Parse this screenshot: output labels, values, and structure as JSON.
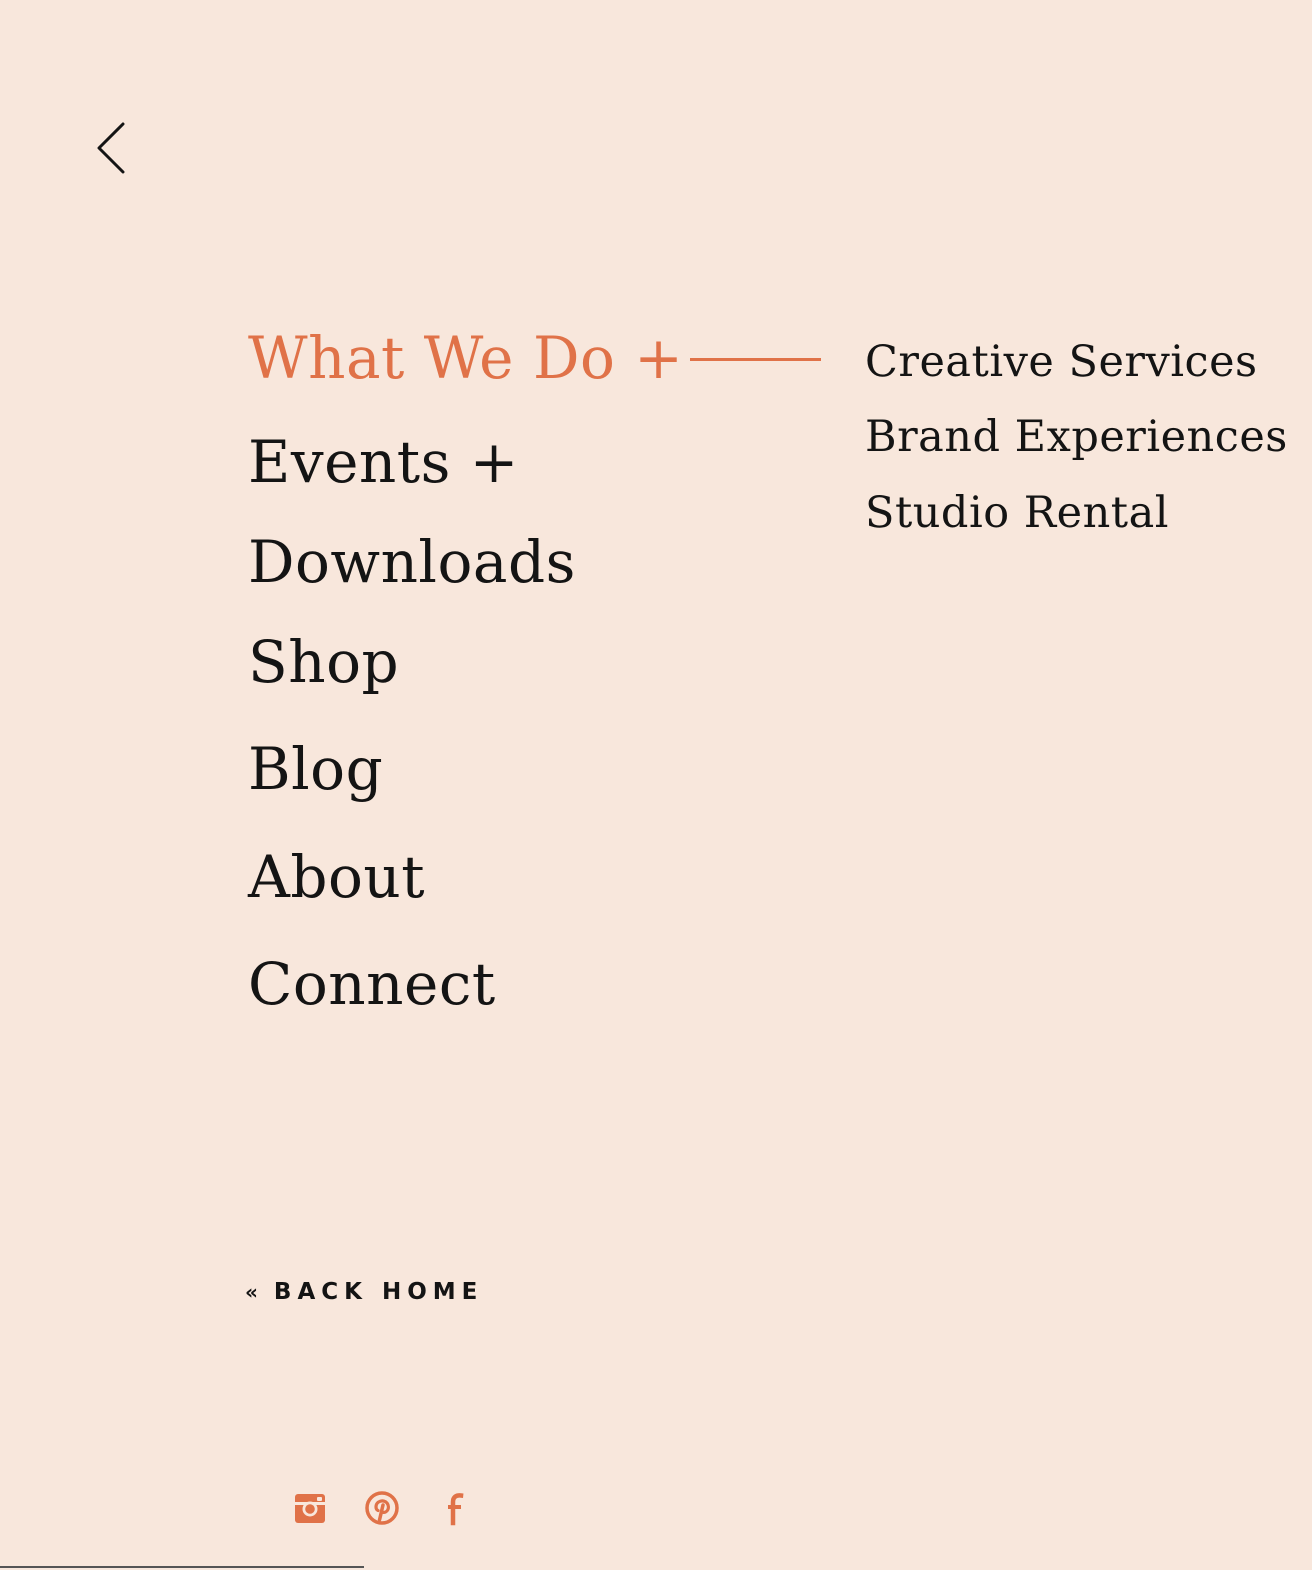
{
  "colors": {
    "background": "#f8e7dc",
    "accent": "#e07248",
    "text": "#141414"
  },
  "back_arrow_icon": "chevron-left-icon",
  "main_nav": {
    "items": [
      {
        "label": "What We Do +",
        "active": true
      },
      {
        "label": "Events +"
      },
      {
        "label": "Downloads"
      },
      {
        "label": "Shop"
      },
      {
        "label": "Blog"
      },
      {
        "label": "About"
      },
      {
        "label": "Connect"
      }
    ]
  },
  "sub_nav": {
    "items": [
      {
        "label": "Creative Services"
      },
      {
        "label": "Brand Experiences"
      },
      {
        "label": "Studio Rental"
      }
    ]
  },
  "back_home": {
    "chevron": "«",
    "label": "BACK HOME"
  },
  "social": {
    "icons": [
      "instagram-icon",
      "pinterest-icon",
      "facebook-icon"
    ]
  }
}
